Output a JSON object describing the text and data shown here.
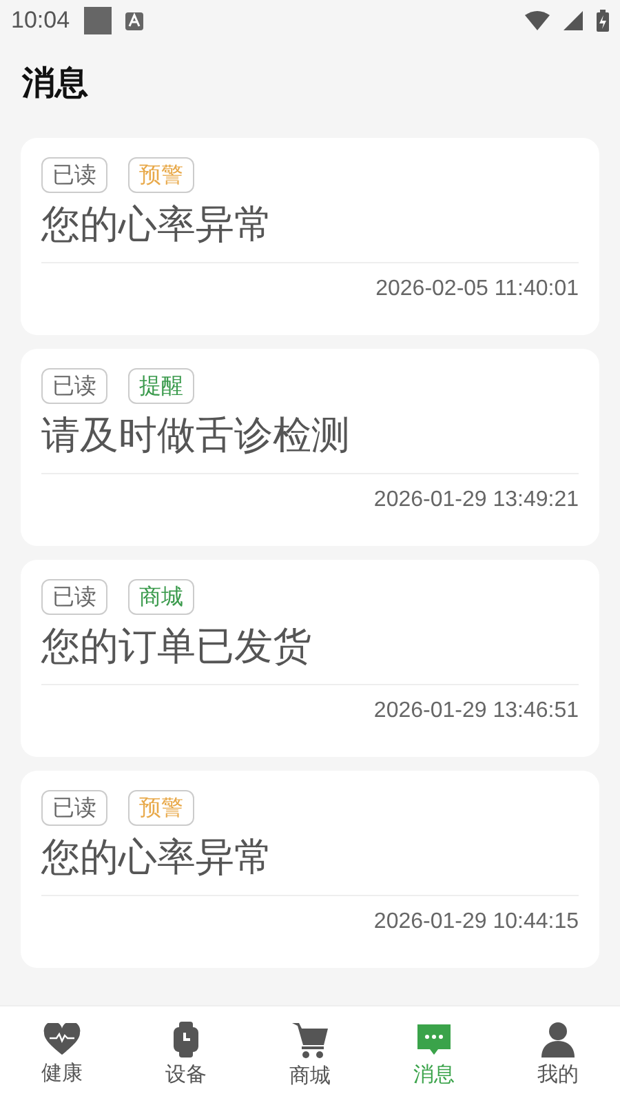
{
  "status_bar": {
    "time": "10:04"
  },
  "title": "消息",
  "messages": [
    {
      "read_label": "已读",
      "tag": {
        "label": "预警",
        "color": "#e8a94a"
      },
      "text": "您的心率异常",
      "time": "2026-02-05 11:40:01"
    },
    {
      "read_label": "已读",
      "tag": {
        "label": "提醒",
        "color": "#3a9a4c"
      },
      "text": "请及时做舌诊检测",
      "time": "2026-01-29 13:49:21"
    },
    {
      "read_label": "已读",
      "tag": {
        "label": "商城",
        "color": "#3a9a4c"
      },
      "text": "您的订单已发货",
      "time": "2026-01-29 13:46:51"
    },
    {
      "read_label": "已读",
      "tag": {
        "label": "预警",
        "color": "#e8a94a"
      },
      "text": "您的心率异常",
      "time": "2026-01-29 10:44:15"
    }
  ],
  "nav": [
    {
      "kind": "health",
      "label": "健康",
      "selected": false
    },
    {
      "kind": "device",
      "label": "设备",
      "selected": false
    },
    {
      "kind": "shop",
      "label": "商城",
      "selected": false
    },
    {
      "kind": "messages",
      "label": "消息",
      "selected": true
    },
    {
      "kind": "profile",
      "label": "我的",
      "selected": false
    }
  ]
}
